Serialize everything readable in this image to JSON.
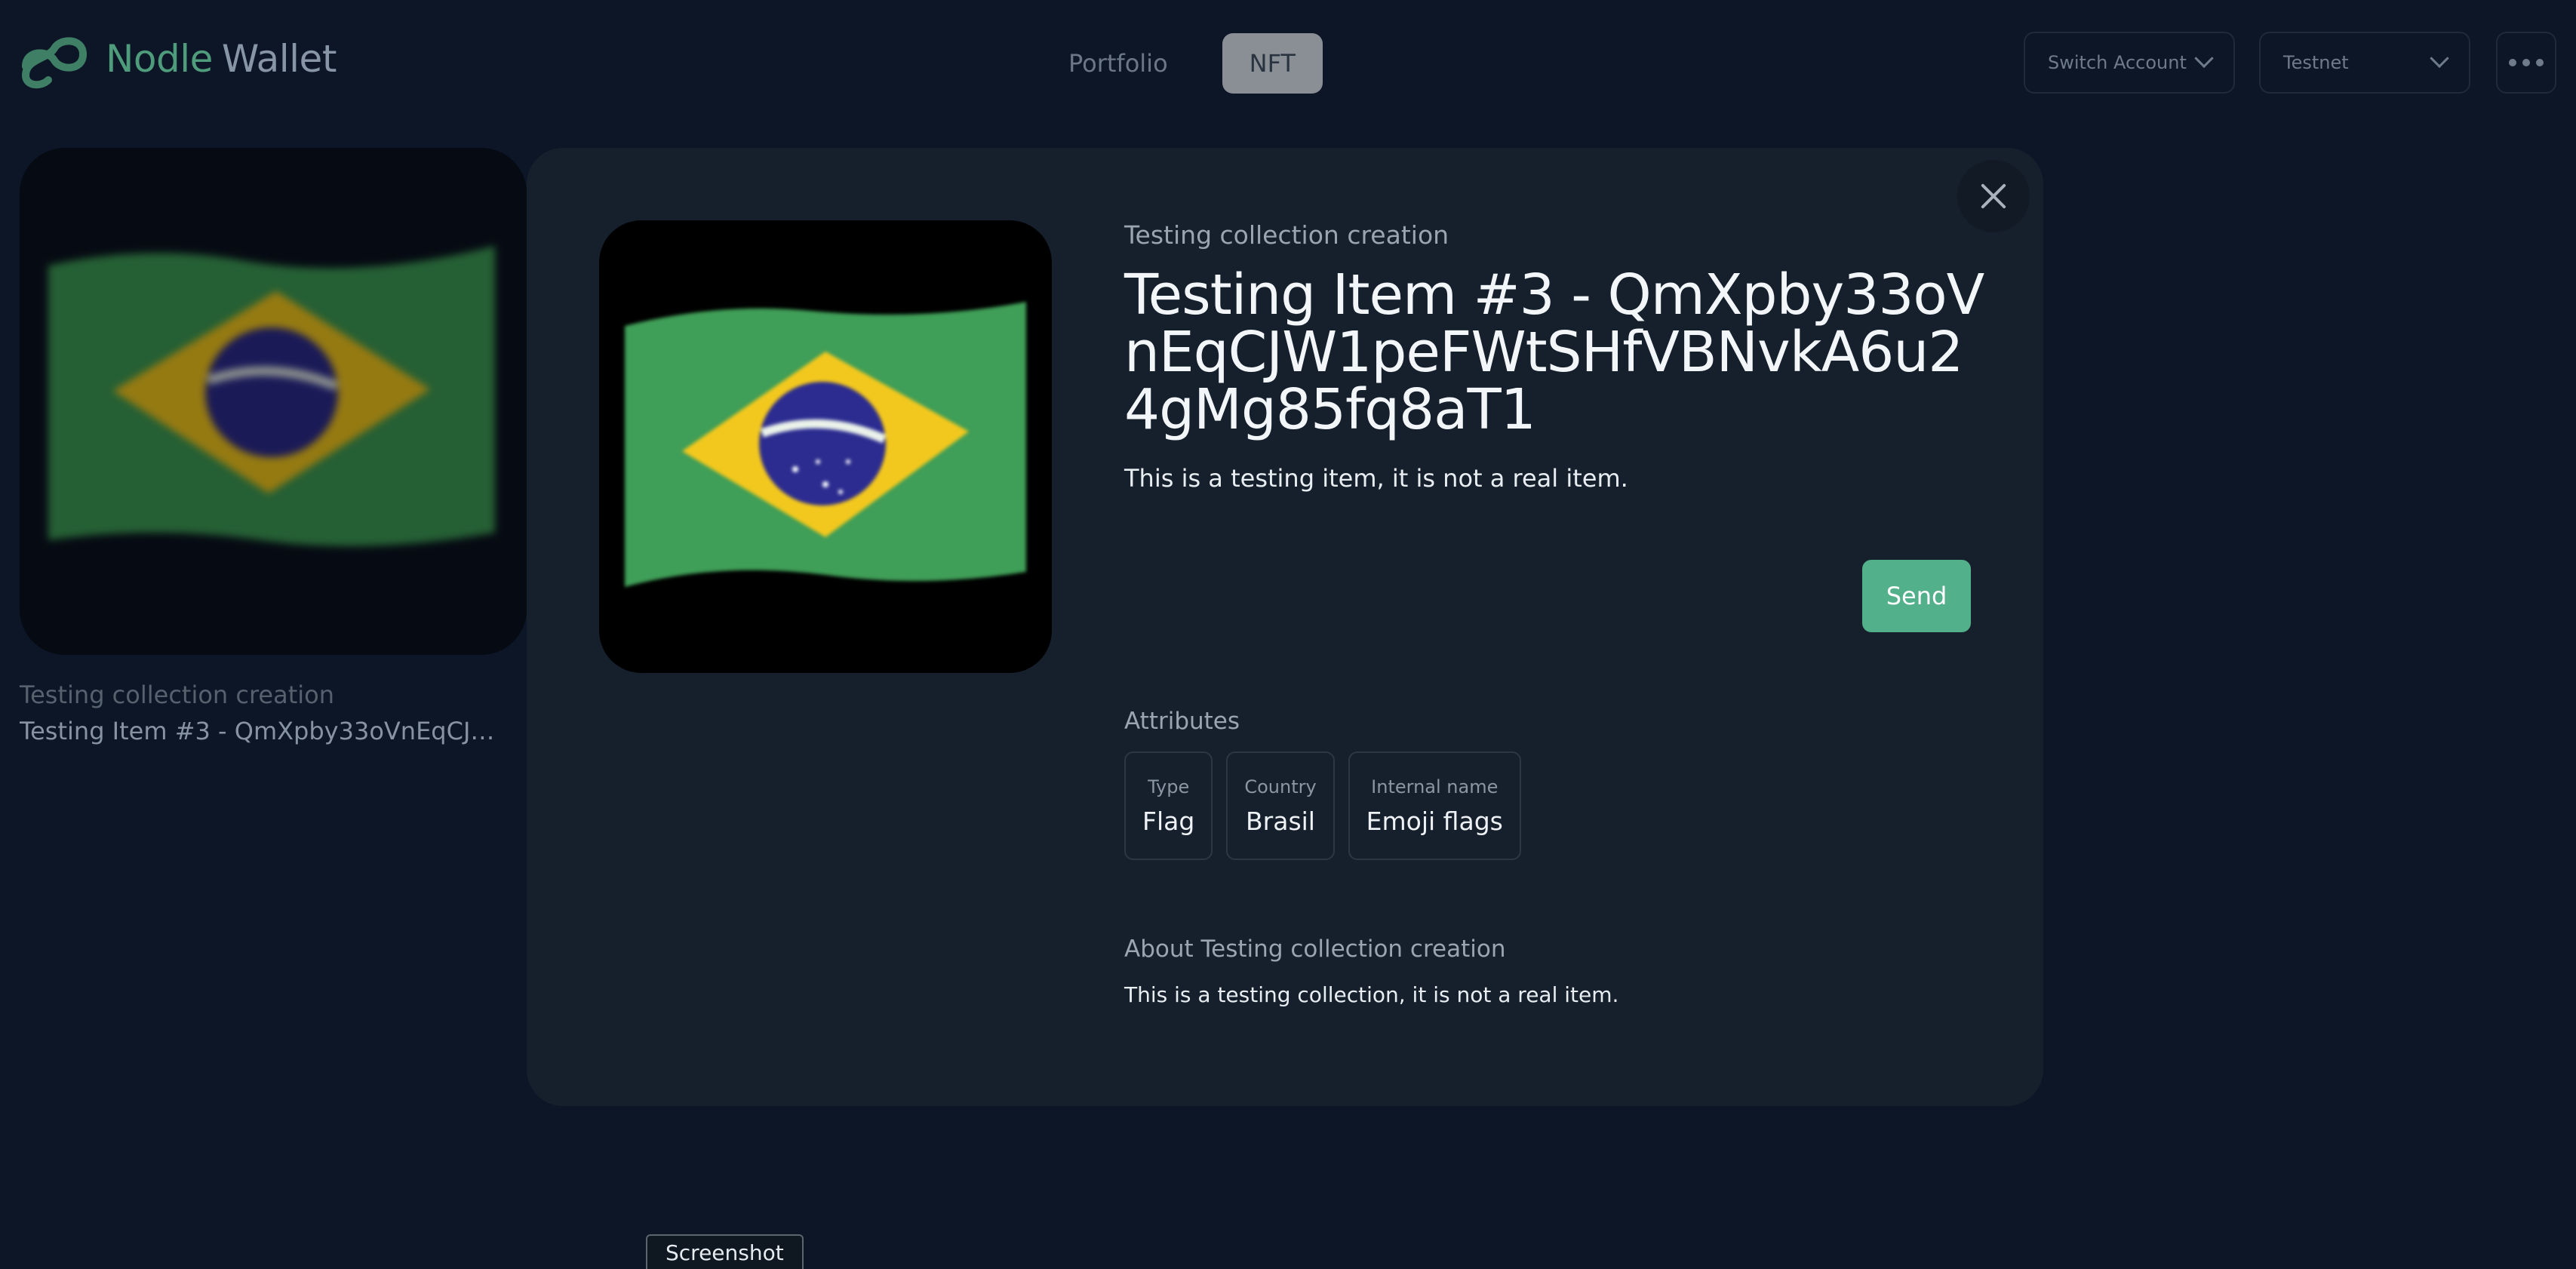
{
  "brand": {
    "name_part1": "Nodle",
    "name_part2": "Wallet",
    "accent": "#4f9c7c"
  },
  "nav": {
    "tabs": [
      {
        "label": "Portfolio",
        "active": false
      },
      {
        "label": "NFT",
        "active": true
      }
    ]
  },
  "header": {
    "switch_account": "Switch Account",
    "network": "Testnet",
    "more_icon": "more-dots-icon"
  },
  "background_card": {
    "collection": "Testing collection creation",
    "title": "Testing Item #3 - QmXpby33oVnEqCJW1peFWtSHfVBNvkA6u24gMg85fq8aT1"
  },
  "modal": {
    "close_icon": "close-icon",
    "collection": "Testing collection creation",
    "title": "Testing Item #3 - QmXpby33oVnEqCJW1peFWtSHfVBNvkA6u24gMg85fq8aT1",
    "description": "This is a testing item, it is not a real item.",
    "send_label": "Send",
    "attributes_heading": "Attributes",
    "attributes": [
      {
        "label": "Type",
        "value": "Flag"
      },
      {
        "label": "Country",
        "value": "Brasil"
      },
      {
        "label": "Internal name",
        "value": "Emoji flags"
      }
    ],
    "about_heading": "About Testing collection creation",
    "about_text": "This is a testing collection, it is not a real item."
  },
  "footer": {
    "screenshot_label": "Screenshot"
  },
  "colors": {
    "background": "#0c1626",
    "modal": "#16202c",
    "send_button": "#52b08a"
  }
}
